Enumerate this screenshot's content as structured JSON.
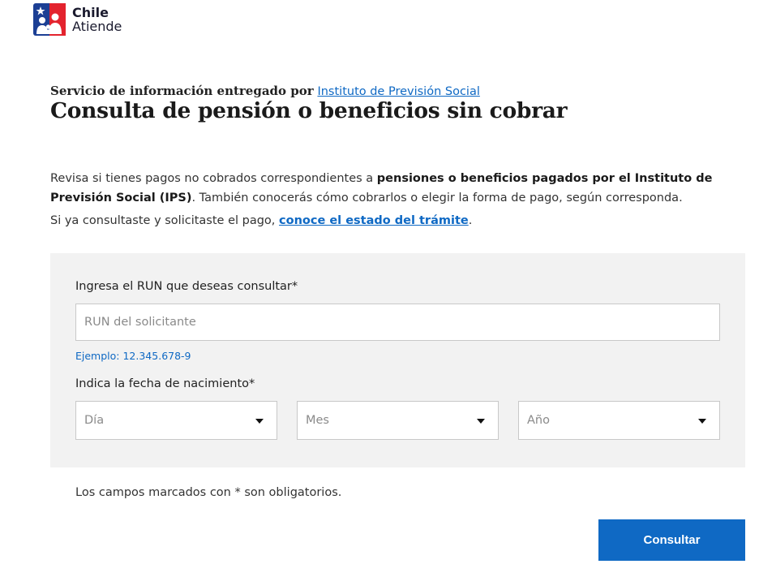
{
  "brand": {
    "line1": "Chile",
    "line2": "Atiende",
    "colors": {
      "blue": "#1c3f94",
      "red": "#e3232e"
    }
  },
  "header": {
    "provider_label": "Servicio de información entregado por",
    "provider_link": "Instituto de Previsión Social",
    "title": "Consulta de pensión o beneficios sin cobrar"
  },
  "intro": {
    "part1": "Revisa si tienes pagos no cobrados correspondientes a",
    "bold": "pensiones o beneficios pagados por el Instituto de Previsión Social (IPS)",
    "part2": ". También conocerás cómo cobrarlos o elegir la forma de pago, según corresponda.",
    "status_text": "Si ya consultaste y solicitaste el pago,",
    "status_link": "conoce el estado del trámite",
    "status_end": "."
  },
  "form": {
    "run_label": "Ingresa el RUN que deseas consultar*",
    "run_placeholder": "RUN del solicitante",
    "run_value": "",
    "run_hint": "Ejemplo: 12.345.678-9",
    "dob_label": "Indica la fecha de nacimiento*",
    "day_placeholder": "Día",
    "month_placeholder": "Mes",
    "year_placeholder": "Año"
  },
  "required_note": "Los campos marcados con * son obligatorios.",
  "submit_label": "Consultar",
  "colors": {
    "link": "#0f69c4",
    "panel": "#f2f2f2",
    "button": "#0f69c4"
  }
}
